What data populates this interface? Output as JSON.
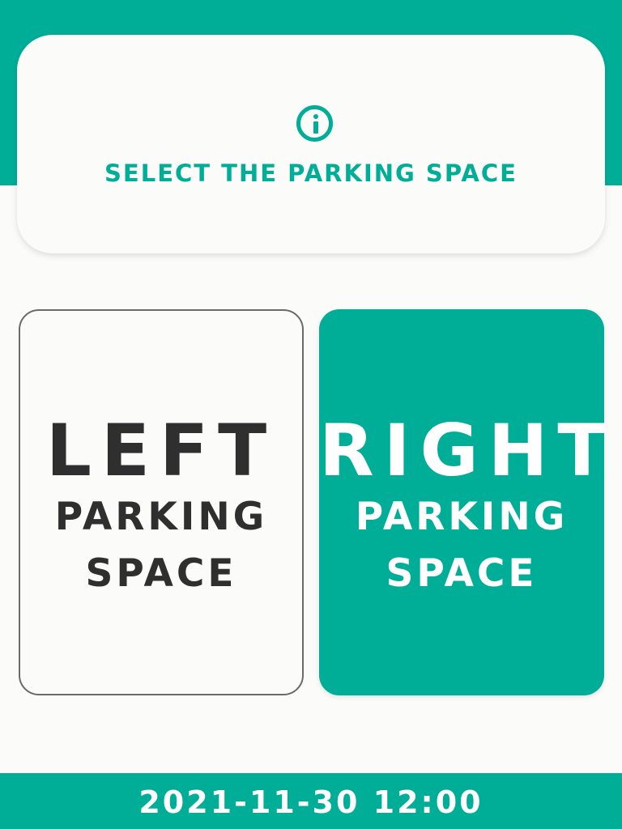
{
  "header": {
    "icon": "info-icon",
    "title": "SELECT THE PARKING SPACE"
  },
  "spaces": [
    {
      "big": "LEFT",
      "line1": "PARKING",
      "line2": "SPACE"
    },
    {
      "big": "RIGHT",
      "line1": "PARKING",
      "line2": "SPACE"
    }
  ],
  "footer": {
    "datetime": "2021-11-30 12:00"
  },
  "colors": {
    "accent": "#00ae97",
    "background": "#fbfbf9",
    "dark_text": "#2f2f2f",
    "card_border": "#6a6a6a"
  }
}
